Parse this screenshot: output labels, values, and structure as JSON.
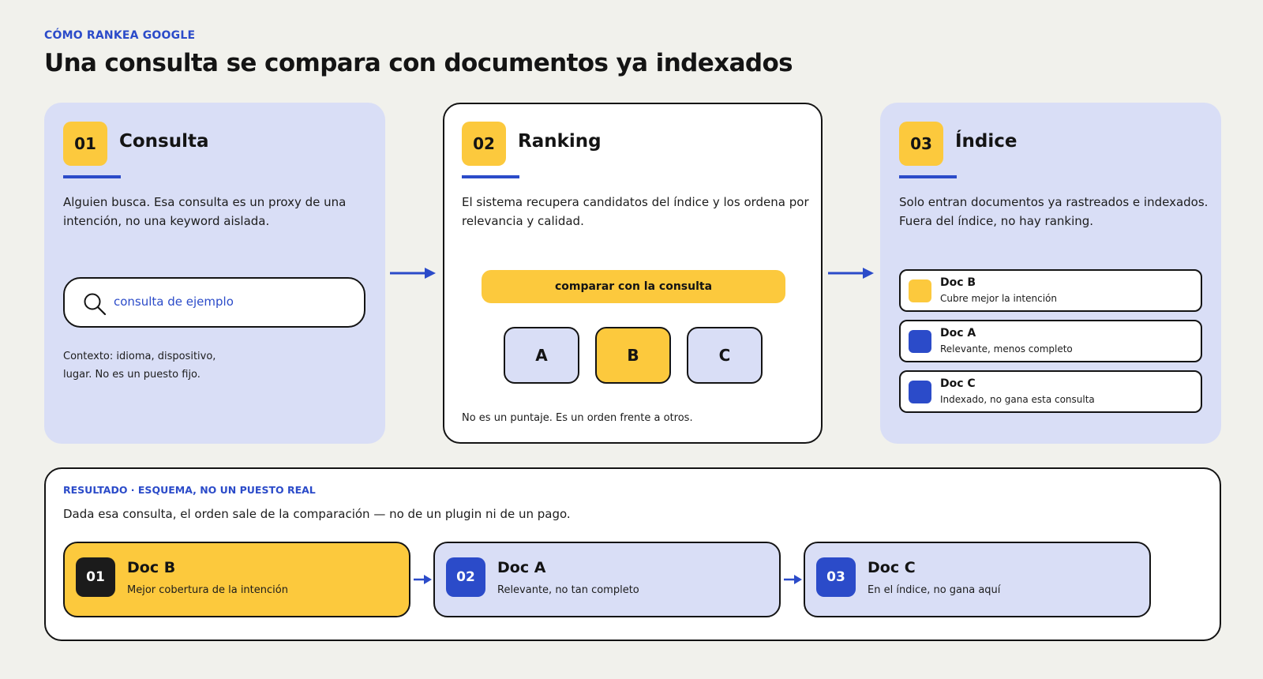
{
  "header": {
    "eyebrow": "CÓMO RANKEA GOOGLE",
    "title": "Una consulta se compara con documentos ya indexados"
  },
  "steps": [
    {
      "number": "01",
      "title": "Consulta",
      "description": "Alguien busca. Esa consulta es un proxy de una intención, no una keyword aislada.",
      "search_text": "consulta de ejemplo",
      "context": "Contexto: idioma, dispositivo, lugar. No es un puesto fijo."
    },
    {
      "number": "02",
      "title": "Ranking",
      "description": "El sistema recupera candidatos del índice y los ordena por relevancia y calidad.",
      "compare_label": "comparar con la consulta",
      "candidates": [
        "A",
        "B",
        "C"
      ],
      "note": "No es un puntaje. Es un orden frente a otros."
    },
    {
      "number": "03",
      "title": "Índice",
      "description": "Solo entran documentos ya rastreados e indexados. Fuera del índice, no hay ranking.",
      "docs": [
        {
          "name": "Doc B",
          "sub": "Cubre mejor la intención",
          "color": "#fcc93d"
        },
        {
          "name": "Doc A",
          "sub": "Relevante, menos completo",
          "color": "#2b4bc9"
        },
        {
          "name": "Doc C",
          "sub": "Indexado, no gana esta consulta",
          "color": "#2b4bc9"
        }
      ]
    }
  ],
  "result": {
    "tag": "RESULTADO · ESQUEMA, NO UN PUESTO REAL",
    "description": "Dada esa consulta, el orden sale de la comparación — no de un plugin ni de un pago.",
    "ranking": [
      {
        "number": "01",
        "name": "Doc B",
        "sub": "Mejor cobertura de la intención"
      },
      {
        "number": "02",
        "name": "Doc A",
        "sub": "Relevante, no tan completo"
      },
      {
        "number": "03",
        "name": "Doc C",
        "sub": "En el índice, no gana aquí"
      }
    ]
  },
  "colors": {
    "accent_blue": "#2b4bc9",
    "accent_yellow": "#fcc93d",
    "panel_blue": "#d9def6",
    "background": "#f1f1ec"
  }
}
